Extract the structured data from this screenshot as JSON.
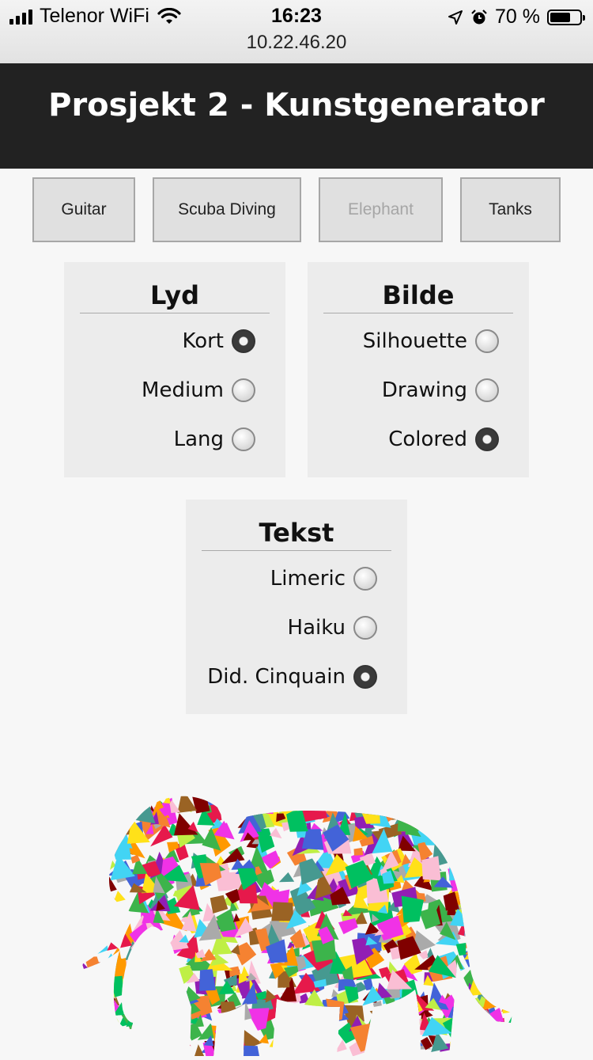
{
  "status_bar": {
    "carrier": "Telenor WiFi",
    "time": "16:23",
    "url": "10.22.46.20",
    "battery_text": "70 %",
    "battery_level": 0.7
  },
  "header": {
    "title": "Prosjekt 2 - Kunstgenerator"
  },
  "topics": [
    {
      "label": "Guitar",
      "disabled": false
    },
    {
      "label": "Scuba Diving",
      "disabled": false
    },
    {
      "label": "Elephant",
      "disabled": true
    },
    {
      "label": "Tanks",
      "disabled": false
    }
  ],
  "panels": {
    "lyd": {
      "title": "Lyd",
      "options": [
        {
          "label": "Kort",
          "checked": true
        },
        {
          "label": "Medium",
          "checked": false
        },
        {
          "label": "Lang",
          "checked": false
        }
      ]
    },
    "bilde": {
      "title": "Bilde",
      "options": [
        {
          "label": "Silhouette",
          "checked": false
        },
        {
          "label": "Drawing",
          "checked": false
        },
        {
          "label": "Colored",
          "checked": true
        }
      ]
    },
    "tekst": {
      "title": "Tekst",
      "options": [
        {
          "label": "Limeric",
          "checked": false
        },
        {
          "label": "Haiku",
          "checked": false
        },
        {
          "label": "Did. Cinquain",
          "checked": true
        }
      ]
    }
  },
  "colors": {
    "header_bg": "#222222",
    "mosaic": [
      "#e6194b",
      "#3cb44b",
      "#ffe119",
      "#4363d8",
      "#f58231",
      "#911eb4",
      "#42d4f4",
      "#f032e6",
      "#bfef45",
      "#fabed4",
      "#469990",
      "#9a6324",
      "#aaaaaa",
      "#800000",
      "#00c060",
      "#ff9900"
    ]
  },
  "icons": [
    "signal-icon",
    "wifi-icon",
    "location-icon",
    "alarm-icon",
    "battery-icon"
  ]
}
